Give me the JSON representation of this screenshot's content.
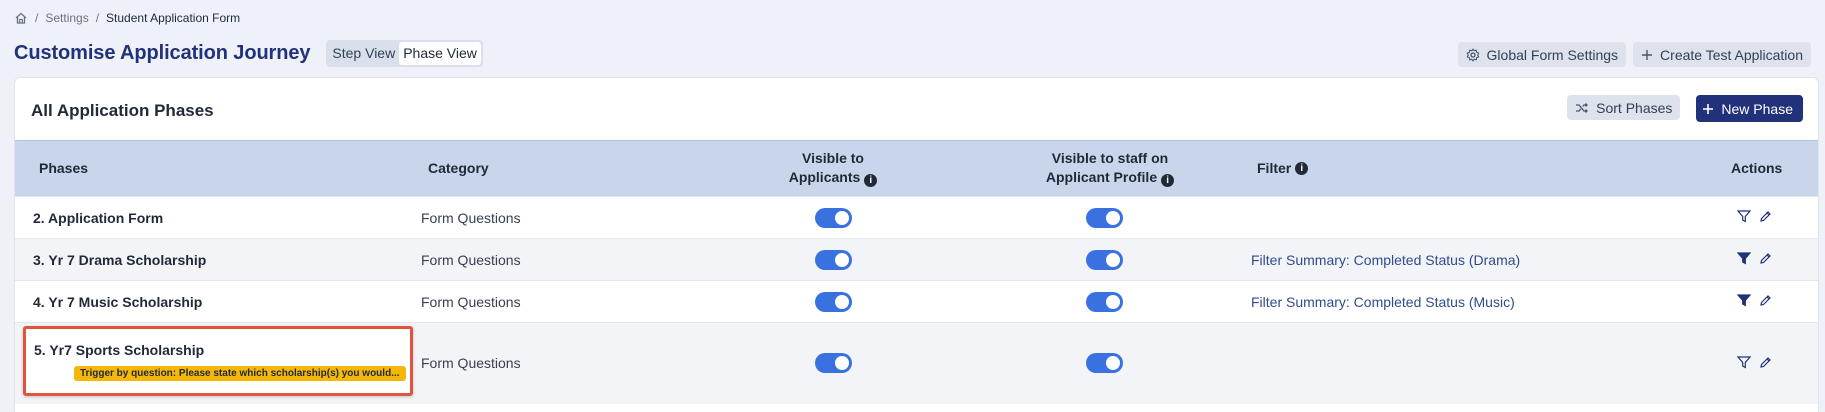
{
  "breadcrumb": {
    "items": [
      "Settings",
      "Student Application Form"
    ]
  },
  "header": {
    "title": "Customise Application Journey",
    "view_toggle": [
      {
        "label": "Step View",
        "active": false
      },
      {
        "label": "Phase View",
        "active": true
      }
    ],
    "global_settings_label": "Global Form Settings",
    "create_test_label": "Create Test Application"
  },
  "card": {
    "title": "All Application Phases",
    "sort_label": "Sort Phases",
    "new_phase_label": "New Phase"
  },
  "table": {
    "headers": {
      "phases": "Phases",
      "category": "Category",
      "visible_applicants_1": "Visible to",
      "visible_applicants_2": "Applicants",
      "visible_staff_1": "Visible to staff on",
      "visible_staff_2": "Applicant Profile",
      "filter": "Filter",
      "actions": "Actions"
    },
    "rows": [
      {
        "phase": "2. Application Form",
        "category": "Form Questions",
        "visible_applicants": true,
        "visible_staff": true,
        "filter": "",
        "filter_active": false
      },
      {
        "phase": "3. Yr 7 Drama Scholarship",
        "category": "Form Questions",
        "visible_applicants": true,
        "visible_staff": true,
        "filter": "Filter Summary: Completed Status (Drama)",
        "filter_active": true
      },
      {
        "phase": "4. Yr 7 Music Scholarship",
        "category": "Form Questions",
        "visible_applicants": true,
        "visible_staff": true,
        "filter": "Filter Summary: Completed Status (Music)",
        "filter_active": true
      },
      {
        "phase": "5. Yr7 Sports Scholarship",
        "category": "Form Questions",
        "visible_applicants": true,
        "visible_staff": true,
        "filter": "",
        "filter_active": false,
        "trigger": "Trigger by question: Please state which scholarship(s) you would..."
      }
    ]
  },
  "colors": {
    "primary": "#22327a",
    "toggle_on": "#3a71e0",
    "table_header": "#c9d5ea",
    "trigger_badge": "#f5b80a",
    "highlight_border": "#e0533d"
  }
}
